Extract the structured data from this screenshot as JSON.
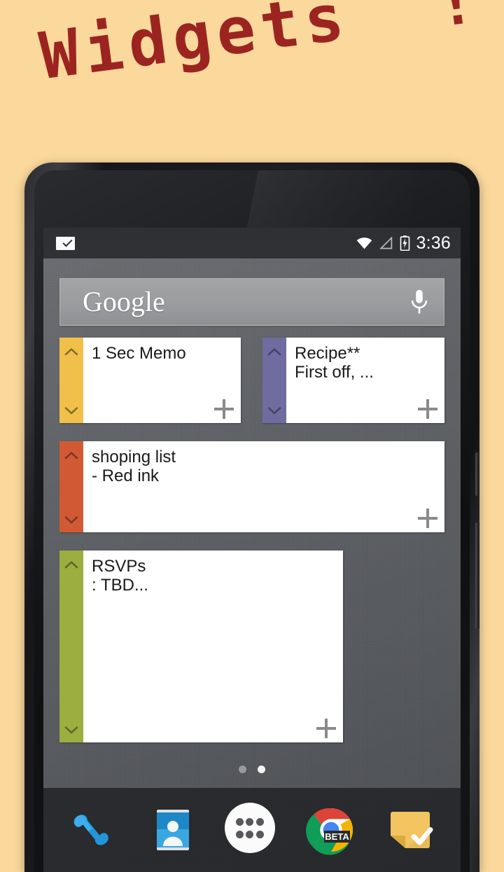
{
  "promo": {
    "title": "Widgets  !",
    "title_color": "#9C2420",
    "background_color": "#FBD89C"
  },
  "status_bar": {
    "notification_icon": "sticky-note-check-icon",
    "wifi_icon": "wifi-icon",
    "signal_icon": "signal-triangle-icon",
    "battery_icon": "battery-charging-icon",
    "time": "3:36"
  },
  "search_widget": {
    "logo_text": "Google",
    "mic_icon": "microphone-icon"
  },
  "notes": [
    {
      "title": "1 Sec Memo",
      "subtitle": "",
      "color": "#F0C04A",
      "up_icon": "chevron-up-icon",
      "down_icon": "chevron-down-icon",
      "add_icon": "plus-icon"
    },
    {
      "title": "Recipe**",
      "subtitle": "First off, ...",
      "color": "#6F6CA0",
      "up_icon": "chevron-up-icon",
      "down_icon": "chevron-down-icon",
      "add_icon": "plus-icon"
    },
    {
      "title": "shoping list",
      "subtitle": "- Red ink",
      "color": "#D15A34",
      "up_icon": "chevron-up-icon",
      "down_icon": "chevron-down-icon",
      "add_icon": "plus-icon"
    },
    {
      "title": "RSVPs",
      "subtitle": ": TBD...",
      "color": "#9DAE40",
      "up_icon": "chevron-up-icon",
      "down_icon": "chevron-down-icon",
      "add_icon": "plus-icon"
    }
  ],
  "home_screen": {
    "page_count": 2,
    "active_page": 2
  },
  "dock": {
    "items": [
      {
        "name": "phone",
        "icon": "phone-handset-icon"
      },
      {
        "name": "contacts",
        "icon": "contacts-card-icon"
      },
      {
        "name": "app-drawer",
        "icon": "app-drawer-icon"
      },
      {
        "name": "chrome",
        "icon": "chrome-icon",
        "badge": "BETA"
      },
      {
        "name": "notes",
        "icon": "sticky-note-check-icon"
      }
    ]
  }
}
